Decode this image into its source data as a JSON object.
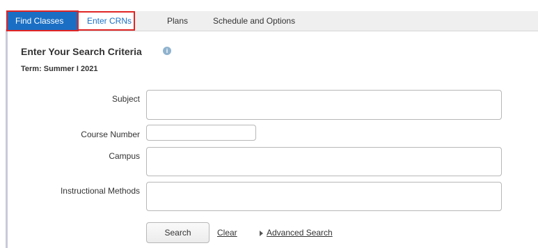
{
  "tabs": [
    {
      "label": "Find Classes"
    },
    {
      "label": "Enter CRNs"
    },
    {
      "label": "Plans"
    },
    {
      "label": "Schedule and Options"
    }
  ],
  "heading": "Enter Your Search Criteria",
  "info_icon_glyph": "i",
  "term": "Term: Summer I 2021",
  "form": {
    "subject_label": "Subject",
    "course_number_label": "Course Number",
    "campus_label": "Campus",
    "instructional_methods_label": "Instructional Methods",
    "subject_value": "",
    "course_number_value": "",
    "campus_value": "",
    "instructional_methods_value": ""
  },
  "actions": {
    "search_label": "Search",
    "clear_label": "Clear",
    "advanced_search_label": "Advanced Search"
  },
  "colors": {
    "active_tab": "#1a6fc4",
    "highlight_outline": "#e02424",
    "info_icon": "#8fb3cf"
  }
}
